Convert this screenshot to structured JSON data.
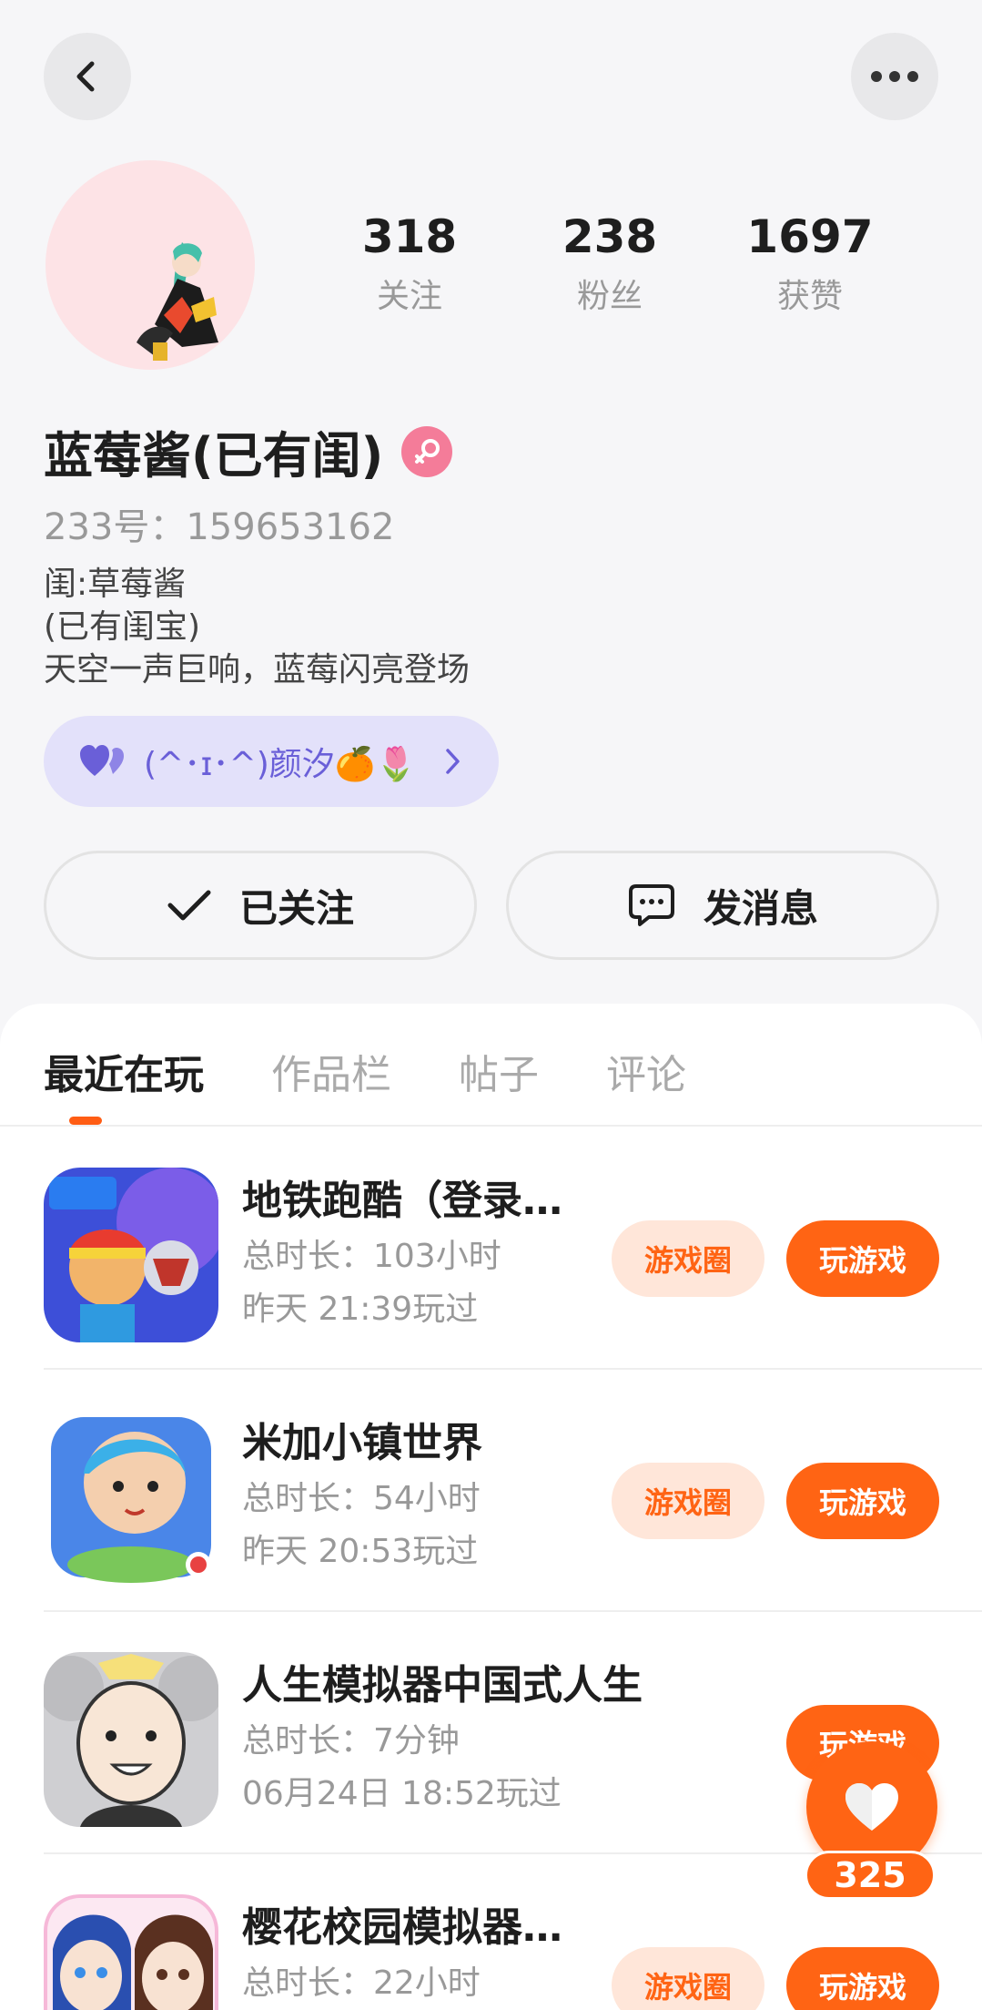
{
  "profile": {
    "name": "蓝莓酱(已有闺)",
    "uid": "233号：159653162",
    "bio": [
      "闺:草莓酱",
      "(已有闺宝)",
      "天空一声巨响，蓝莓闪亮登场"
    ],
    "gender": "female"
  },
  "stats": [
    {
      "value": "318",
      "label": "关注"
    },
    {
      "value": "238",
      "label": "粉丝"
    },
    {
      "value": "1697",
      "label": "获赞"
    }
  ],
  "relation": {
    "text": "(^･ɪ･^)颜汐🍊🌷"
  },
  "actions": {
    "follow_label": "已关注",
    "message_label": "发消息"
  },
  "tabs": [
    "最近在玩",
    "作品栏",
    "帖子",
    "评论"
  ],
  "games": [
    {
      "title": "地铁跑酷（登录…",
      "duration": "总时长：103小时",
      "last_played": "昨天  21:39玩过",
      "circle_label": "游戏圈",
      "play_label": "玩游戏"
    },
    {
      "title": "米加小镇世界",
      "duration": "总时长：54小时",
      "last_played": "昨天  20:53玩过",
      "circle_label": "游戏圈",
      "play_label": "玩游戏"
    },
    {
      "title": "人生模拟器中国式人生",
      "duration": "总时长：7分钟",
      "last_played": "06月24日  18:52玩过",
      "circle_label": "",
      "play_label": "玩游戏"
    },
    {
      "title": "樱花校园模拟器…",
      "duration": "总时长：22小时",
      "last_played": "",
      "circle_label": "游戏圈",
      "play_label": "玩游戏"
    }
  ],
  "like_fab": {
    "count": "325"
  },
  "colors": {
    "accent": "#ff6414",
    "accent_light": "#ffe6d9",
    "relation_bg": "#e3e1fa",
    "relation_text": "#6a5fd8"
  }
}
